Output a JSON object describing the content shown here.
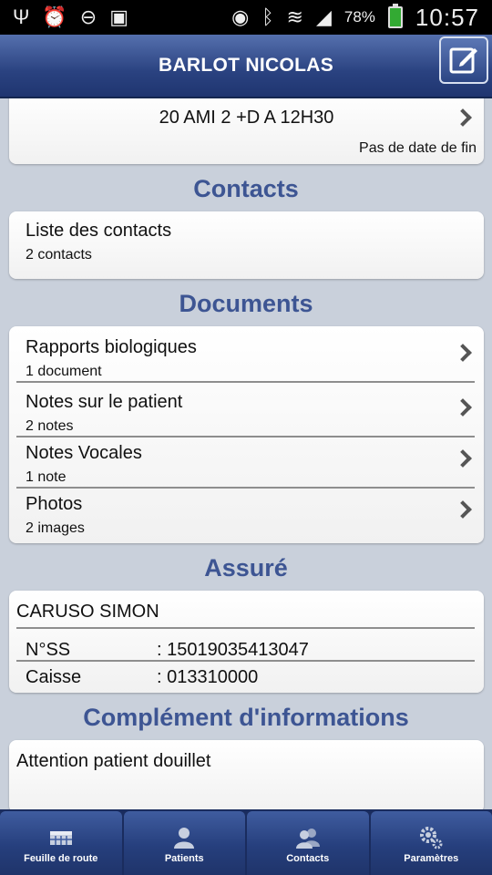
{
  "statusbar": {
    "battery": "78%",
    "time": "10:57"
  },
  "header": {
    "title": "BARLOT NICOLAS"
  },
  "schedule": {
    "title": "20 AMI 2 +D  A 12H30",
    "end_note": "Pas de date de fin"
  },
  "contacts": {
    "section_title": "Contacts",
    "items": [
      {
        "title": "Liste des contacts",
        "sub": "2 contacts"
      }
    ]
  },
  "documents": {
    "section_title": "Documents",
    "items": [
      {
        "title": "Rapports biologiques",
        "sub": "1 document"
      },
      {
        "title": "Notes sur le patient",
        "sub": "2 notes"
      },
      {
        "title": "Notes Vocales",
        "sub": "1 note"
      },
      {
        "title": "Photos",
        "sub": "2 images"
      }
    ]
  },
  "assure": {
    "section_title": "Assuré",
    "name": "CARUSO SIMON",
    "nss_label": "N°SS",
    "nss_value": ": 15019035413047",
    "caisse_label": "Caisse",
    "caisse_value": ": 013310000"
  },
  "complement": {
    "section_title": "Complément d'informations",
    "text": "Attention patient douillet"
  },
  "tabs": [
    {
      "label": "Feuille de route",
      "icon": "route-sheet-icon"
    },
    {
      "label": "Patients",
      "icon": "patient-icon"
    },
    {
      "label": "Contacts",
      "icon": "contacts-icon"
    },
    {
      "label": "Paramètres",
      "icon": "gear-icon"
    }
  ]
}
